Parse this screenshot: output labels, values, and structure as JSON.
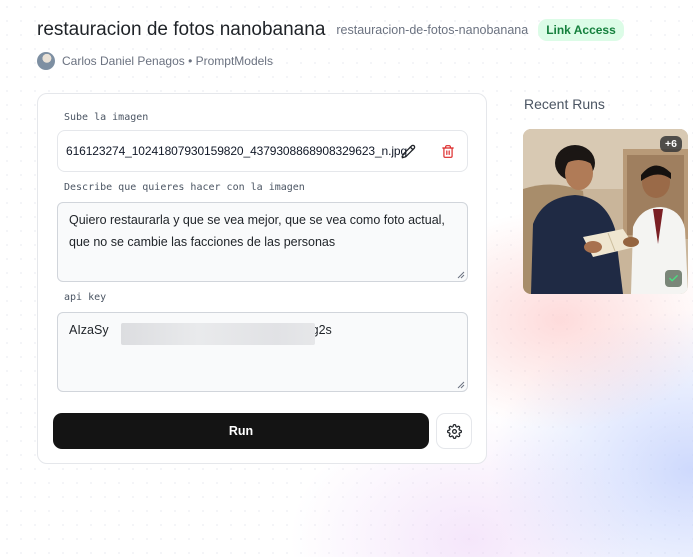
{
  "header": {
    "title": "restauracion de fotos nanobanana",
    "slug": "restauracion-de-fotos-nanobanana",
    "badge": "Link Access"
  },
  "author": {
    "text": "Carlos Daniel Penagos • PromptModels"
  },
  "form": {
    "image_label": "Sube la imagen",
    "file_name": "616123274_10241807930159820_4379308868908329623_n.jpg",
    "describe_label": "Describe que quieres hacer con la imagen",
    "describe_value": "Quiero restaurarla y que se vea mejor, que se vea como foto actual, que no se cambie las facciones de las personas",
    "apikey_label": "api key",
    "apikey_prefix": "AIzaSy",
    "apikey_suffix": "wg2s",
    "run_label": "Run"
  },
  "recent": {
    "title": "Recent Runs",
    "count_badge": "+6"
  },
  "colors": {
    "badge_bg": "#dcfce7",
    "badge_text": "#15803d",
    "run_button": "#141414",
    "delete_icon": "#dc2626"
  },
  "icons": {
    "edit": "pencil-icon",
    "delete": "trash-icon",
    "settings": "gear-icon",
    "status": "check-icon"
  }
}
